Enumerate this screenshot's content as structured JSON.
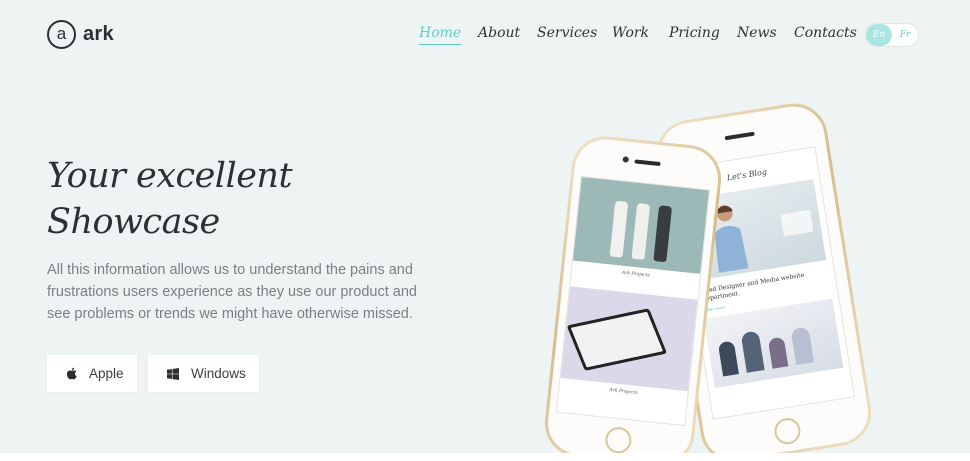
{
  "brand": {
    "logo_letter": "a",
    "logo_text": "ark"
  },
  "nav": {
    "items": [
      {
        "label": "Home",
        "active": true
      },
      {
        "label": "About"
      },
      {
        "label": "Services"
      },
      {
        "label": "Work"
      },
      {
        "label": "Pricing"
      },
      {
        "label": "News"
      },
      {
        "label": "Contacts"
      }
    ],
    "lang": {
      "current": "En",
      "other": "Fr"
    }
  },
  "hero": {
    "title_line1": "Your excellent",
    "title_line2": "Showcase",
    "text": "All this information allows us to understand the pains and frustrations users experience as they use our product and see problems or trends we might have otherwise missed.",
    "buttons": {
      "apple": "Apple",
      "windows": "Windows"
    }
  },
  "phones": {
    "blog_title": "Let's Blog",
    "blog_post_title": "Lead Designer and Media website department.",
    "blog_link": "Learn more",
    "project_caption_1": "Ark Projects",
    "project_caption_2": "Ark Projects"
  },
  "colors": {
    "accent": "#5ccfc6",
    "background": "#eef3f3"
  }
}
